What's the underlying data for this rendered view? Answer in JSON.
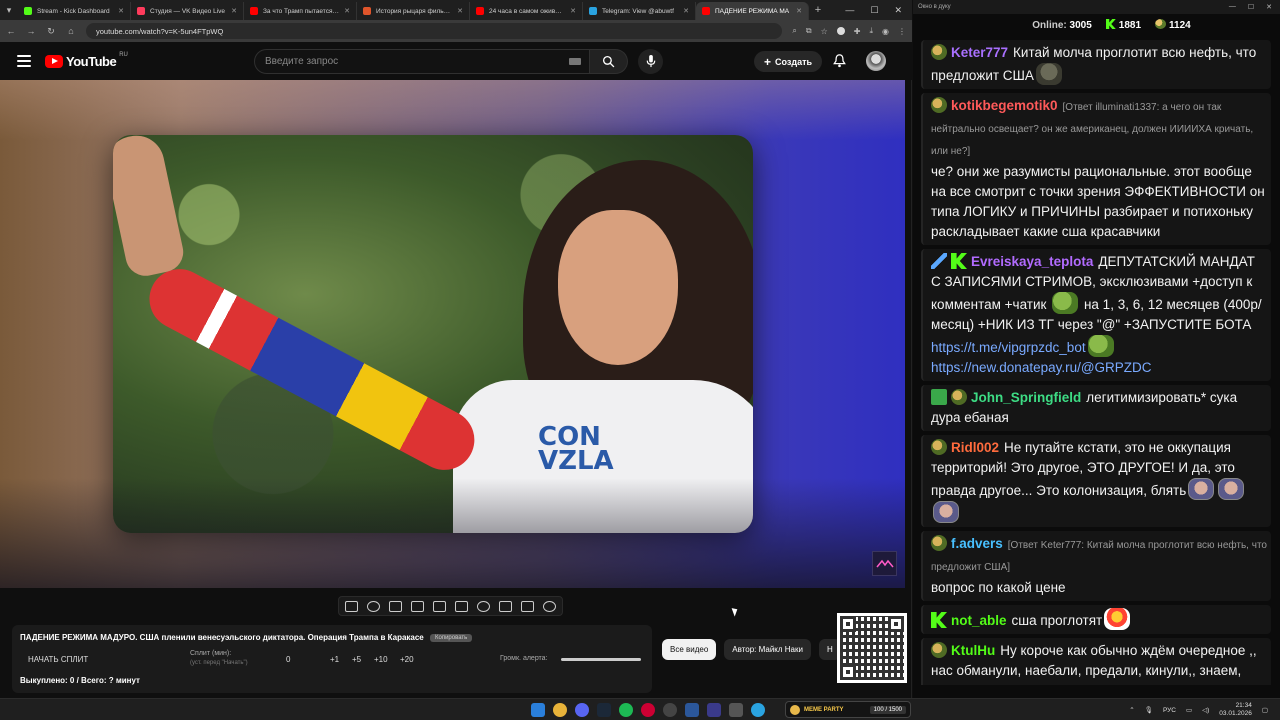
{
  "browser": {
    "tabs": [
      {
        "title": "Stream - Kick Dashboard",
        "color": "#53fc18"
      },
      {
        "title": "Студия — VK Видео Live",
        "color": "#ff3b5c"
      },
      {
        "title": "За что Трамп пытается убить",
        "color": "#ff0000"
      },
      {
        "title": "История рыцаря фильм, 20",
        "color": "#e0552b"
      },
      {
        "title": "24 часа в самом оживленн",
        "color": "#ff0000"
      },
      {
        "title": "Telegram: View @abuwtf",
        "color": "#2aa3e0"
      },
      {
        "title": "ПАДЕНИЕ РЕЖИМА МА",
        "color": "#ff0000"
      }
    ],
    "url": "youtube.com/watch?v=K-5un4FTpWQ"
  },
  "youtube": {
    "logo_text": "YouTube",
    "region": "RU",
    "search_placeholder": "Введите запрос",
    "create_label": "Создать"
  },
  "helper": {
    "title": "ПАДЕНИЕ РЕЖИМА МАДУРО. США пленили венесуэльского диктатора. Операция Трампа в Каракасе",
    "copy_label": "Копировать",
    "start_split": "НАЧАТЬ СПЛИТ",
    "split_label": "Сплит (мин):",
    "split_hint": "(уст. перед \"Начать\")",
    "counter": "0",
    "increments": [
      "+1",
      "+5",
      "+10",
      "+20"
    ],
    "volume_label": "Громк. алерта:",
    "volume_level": 1.0,
    "bought": "Выкуплено: 0 / Всего: ? минут"
  },
  "chips": [
    "Все видео",
    "Автор: Майкл Наки",
    "Н"
  ],
  "chat": {
    "window_title": "Окно в дуку",
    "online_label": "Online:",
    "online_count": "3005",
    "kick_count": "1881",
    "other_count": "1124",
    "messages": [
      {
        "user": "Keter777",
        "color": "#a970ff",
        "badges": [
          "pepe"
        ],
        "reply": "",
        "text": "Китай молча проглотит всю нефть, что предложит США",
        "emote": "bear"
      },
      {
        "user": "kotikbegemotik0",
        "color": "#ff5a5a",
        "badges": [
          "pepe"
        ],
        "reply": "[Ответ illuminati1337: а чего он так нейтрально освещает? он же американец, должен ИИИИХА кричать, или не?]",
        "text": "че? они же разумисты рациональные. этот вообще на все смотрит с точки зрения ЭФФЕКТИВНОСТИ он типа ЛОГИКУ и ПРИЧИНЫ разбирает и потихоньку раскладывает какие сша красавчики",
        "emote": ""
      },
      {
        "user": "Evreiskaya_teplota",
        "color": "#b26bff",
        "badges": [
          "blade",
          "kick"
        ],
        "reply": "",
        "text": "ДЕПУТАТСКИЙ МАНДАТ С ЗАПИСЯМИ СТРИМОВ, эксклюзивами +доступ к комментам +чатик",
        "text2": "на 1, 3, 6, 12 месяцев (400р/месяц) +НИК ИЗ ТГ через \"@\" +ЗАПУСТИТЕ БОТА",
        "link1": "https://t.me/vipgrpzdc_bot",
        "link2": "https://new.donatepay.ru/@GRPZDC",
        "emote": "frog"
      },
      {
        "user": "John_Springfield",
        "color": "#3ddc84",
        "badges": [
          "check",
          "pepe"
        ],
        "reply": "",
        "text": "легитимизировать* сука дура ебаная",
        "emote": ""
      },
      {
        "user": "Ridl002",
        "color": "#ff6b3d",
        "badges": [
          "pepe"
        ],
        "reply": "",
        "text": "Не путайте кстати, это не оккупация территорий! Это другое, ЭТО ДРУГОЕ! И да, это правда другое... Это колонизация, блять",
        "emote": "face"
      },
      {
        "user": "f.advers",
        "color": "#48c0ff",
        "badges": [
          "pepe"
        ],
        "reply": "[Ответ Keter777: Китай молча проглотит всю нефть, что предложит США]",
        "text": "вопрос по какой цене",
        "emote": ""
      },
      {
        "user": "not_able",
        "color": "#53fc18",
        "badges": [
          "kick"
        ],
        "reply": "",
        "text": "сша проглотят",
        "emote": "parrot"
      },
      {
        "user": "KtulHu",
        "color": "#53fc18",
        "badges": [
          "pepe"
        ],
        "reply": "",
        "text": "Ну короче как обычно ждём очередное ,, нас обманули, наебали, предали, кинули,,  знаем, проходили",
        "emote": ""
      }
    ]
  },
  "taskbar": {
    "meme_label": "MEME PARTY",
    "meme_progress": "100 / 1500",
    "lang": "РУС",
    "time": "21:34",
    "date": "03.01.2026"
  }
}
